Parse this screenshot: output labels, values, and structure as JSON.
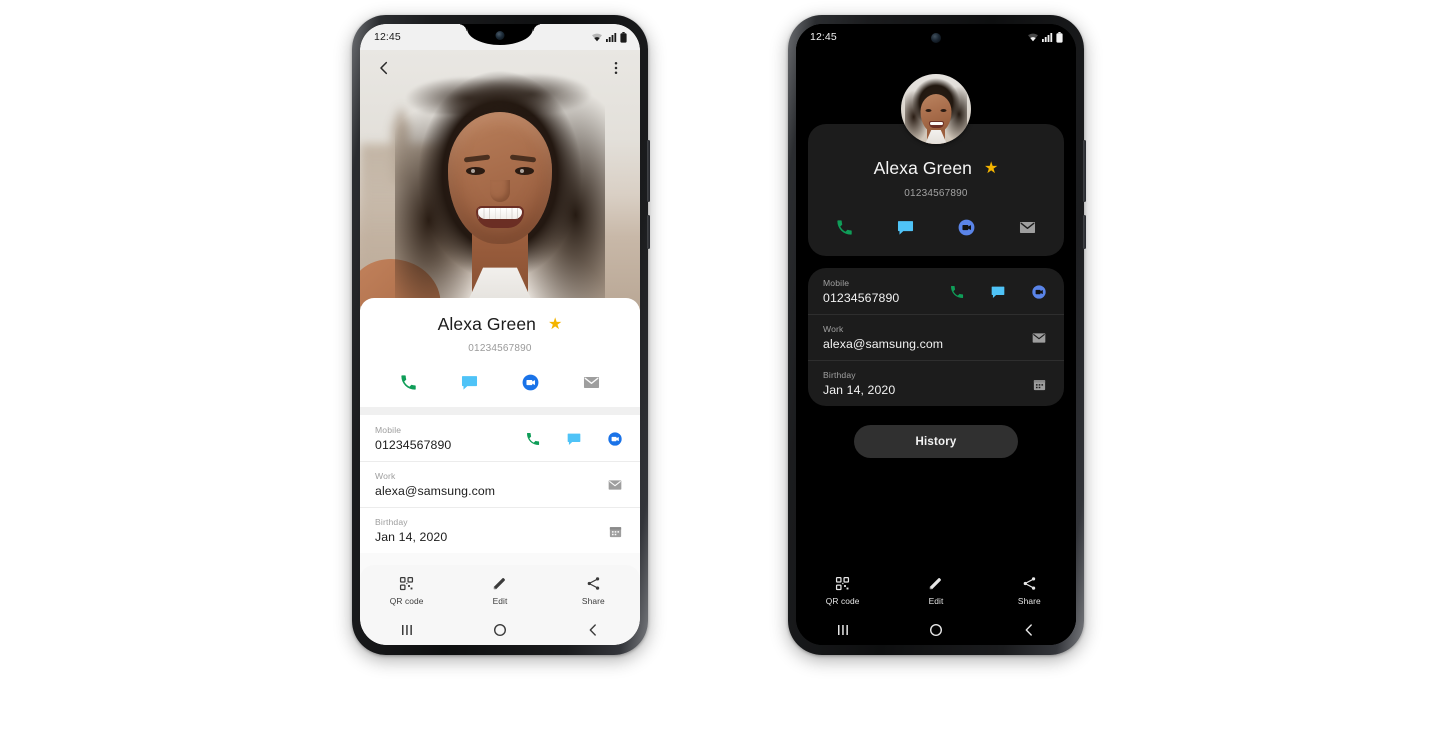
{
  "scene": {
    "background_color": "#ffffff",
    "phones": [
      "light-theme-contact-details",
      "dark-theme-contact-details"
    ]
  },
  "status_bar": {
    "time": "12:45",
    "icons": [
      "wifi-icon",
      "signal-icon",
      "battery-icon"
    ]
  },
  "contact": {
    "name": "Alexa Green",
    "phone_number": "01234567890",
    "favorite": true,
    "favorite_star_color": "#f4b400",
    "quick_actions": [
      {
        "name": "call-action",
        "icon": "phone-icon",
        "color": "#0f9d58"
      },
      {
        "name": "message-action",
        "icon": "message-icon",
        "color": "#4fc3f7"
      },
      {
        "name": "video-call-action",
        "icon": "duo-video-icon",
        "color": "#1a73e8"
      },
      {
        "name": "email-action",
        "icon": "envelope-icon",
        "color": "#9e9e9e"
      }
    ],
    "details": [
      {
        "label": "Mobile",
        "value": "01234567890",
        "icons": [
          {
            "name": "phone-icon",
            "color": "#0f9d58"
          },
          {
            "name": "message-icon",
            "color": "#4fc3f7"
          },
          {
            "name": "duo-video-icon",
            "color": "#1a73e8"
          }
        ]
      },
      {
        "label": "Work",
        "value": "alexa@samsung.com",
        "icons": [
          {
            "name": "envelope-icon",
            "color": "#9e9e9e"
          }
        ]
      },
      {
        "label": "Birthday",
        "value": "Jan 14, 2020",
        "icons": [
          {
            "name": "calendar-icon",
            "color": "#9e9e9e"
          }
        ]
      }
    ],
    "history_button": "History"
  },
  "bottom_toolbar": [
    {
      "label": "QR code",
      "icon": "qr-code-icon"
    },
    {
      "label": "Edit",
      "icon": "pencil-icon"
    },
    {
      "label": "Share",
      "icon": "share-icon"
    }
  ],
  "nav_bar": [
    {
      "name": "recents-button",
      "icon": "three-bars-icon"
    },
    {
      "name": "home-button",
      "icon": "circle-icon"
    },
    {
      "name": "back-button",
      "icon": "chevron-left-icon"
    }
  ],
  "header": {
    "back_icon": "chevron-left-icon",
    "more_icon": "more-vertical-icon"
  },
  "theme": {
    "light_bg": "#fafafa",
    "light_card": "#ffffff",
    "dark_bg": "#000000",
    "dark_card": "#1c1c1c",
    "dark_button": "#303030"
  }
}
